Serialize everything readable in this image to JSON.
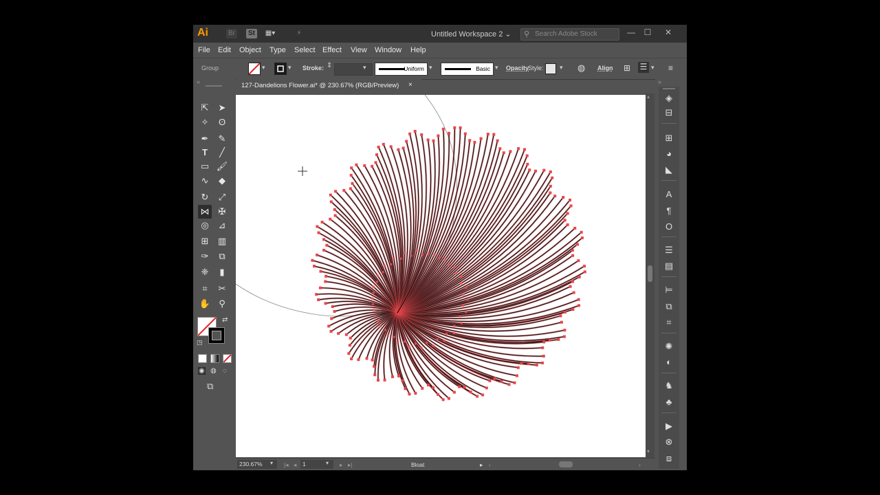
{
  "app": {
    "logo": "Ai",
    "bridge_label": "Br",
    "stock_label": "St",
    "workspace": "Untitled Workspace 2",
    "search_placeholder": "Search Adobe Stock"
  },
  "menu": [
    "File",
    "Edit",
    "Object",
    "Type",
    "Select",
    "Effect",
    "View",
    "Window",
    "Help"
  ],
  "control_bar": {
    "selection_type": "Group",
    "stroke_label": "Stroke:",
    "stroke_profile": "Uniform",
    "brush": "Basic",
    "opacity_label": "Opacity",
    "style_label": "Style:",
    "align_label": "Align"
  },
  "document": {
    "tab_title": "127-Dandelions Flower.ai* @ 230.67% (RGB/Preview)",
    "close_label": "×"
  },
  "status": {
    "zoom": "230.67%",
    "artboard": "1",
    "tool_name": "Bloat"
  },
  "colors": {
    "app_bg": "#535353",
    "titlebar": "#323232",
    "path_highlight": "#e8474b",
    "anchor": "#e8474b",
    "logo_orange": "#ff9a00"
  }
}
